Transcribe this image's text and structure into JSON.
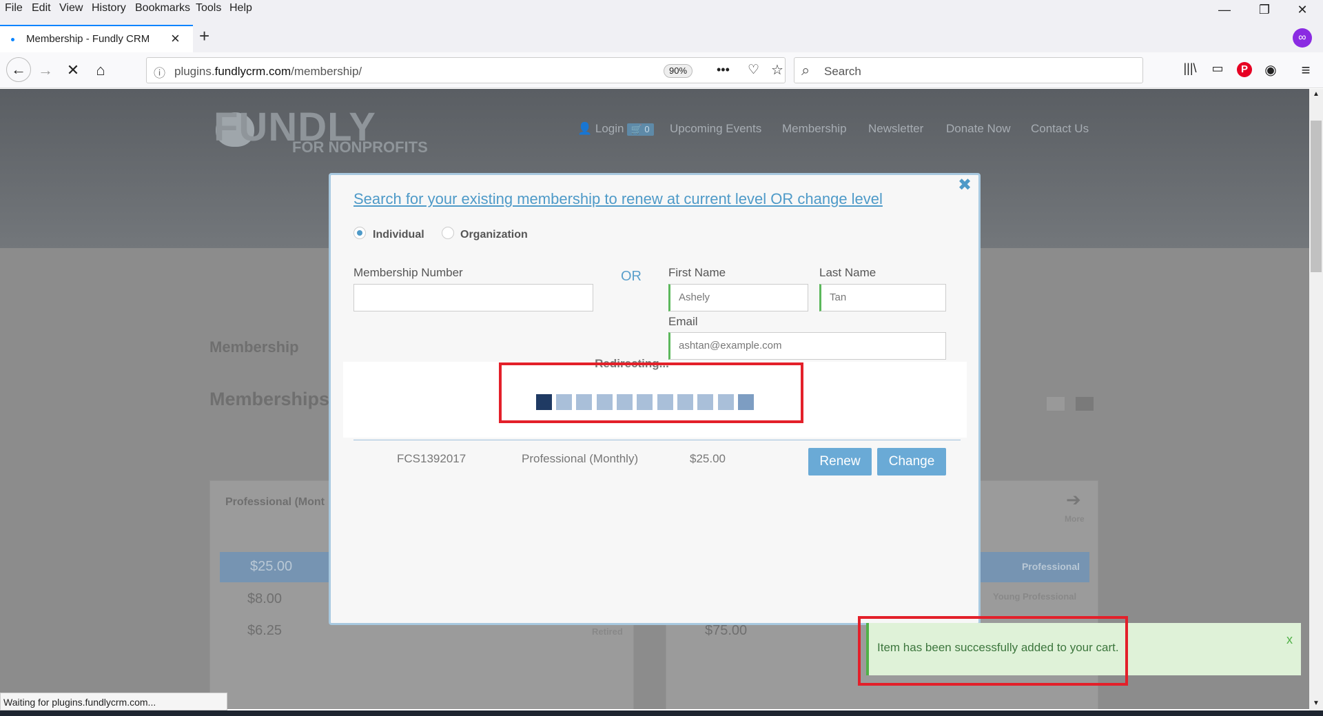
{
  "menu": [
    "File",
    "Edit",
    "View",
    "History",
    "Bookmarks",
    "Tools",
    "Help"
  ],
  "tab": {
    "title": "Membership - Fundly CRM"
  },
  "address": {
    "prefix": "plugins.",
    "domain": "fundlycrm.com",
    "path": "/membership/",
    "zoom": "90%"
  },
  "search": {
    "placeholder": "Search"
  },
  "site": {
    "logo": "FUNDLY",
    "logo_sub": "FOR NONPROFITS",
    "nav": {
      "login": "Login",
      "cart_count": "0",
      "events": "Upcoming Events",
      "membership": "Membership",
      "newsletter": "Newsletter",
      "donate": "Donate Now",
      "contact": "Contact Us"
    },
    "bg": {
      "membership": "Membership",
      "memberships": "Memberships",
      "card_title": "Professional (Mont",
      "more": "More",
      "p1": "$25.00",
      "p2": "$8.00",
      "p3": "$6.25",
      "retired": "Retired",
      "professional": "Professional",
      "young": "Young Professional",
      "p4": "$75.00"
    }
  },
  "modal": {
    "title": "Search for your existing membership to renew at current level OR change level",
    "close": "✖",
    "radio_individual": "Individual",
    "radio_organization": "Organization",
    "membership_number_label": "Membership Number",
    "or": "OR",
    "first_name_label": "First Name",
    "first_name": "Ashely",
    "last_name_label": "Last Name",
    "last_name": "Tan",
    "email_label": "Email",
    "email": "ashtan@example.com",
    "redirecting": "Redirecting...",
    "result": {
      "number": "FCS1392017",
      "level": "Professional (Monthly)",
      "price": "$25.00"
    },
    "renew": "Renew",
    "change": "Change"
  },
  "toast": {
    "message": "Item has been successfully added to your cart.",
    "close": "x"
  },
  "status": "Waiting for plugins.fundlycrm.com..."
}
